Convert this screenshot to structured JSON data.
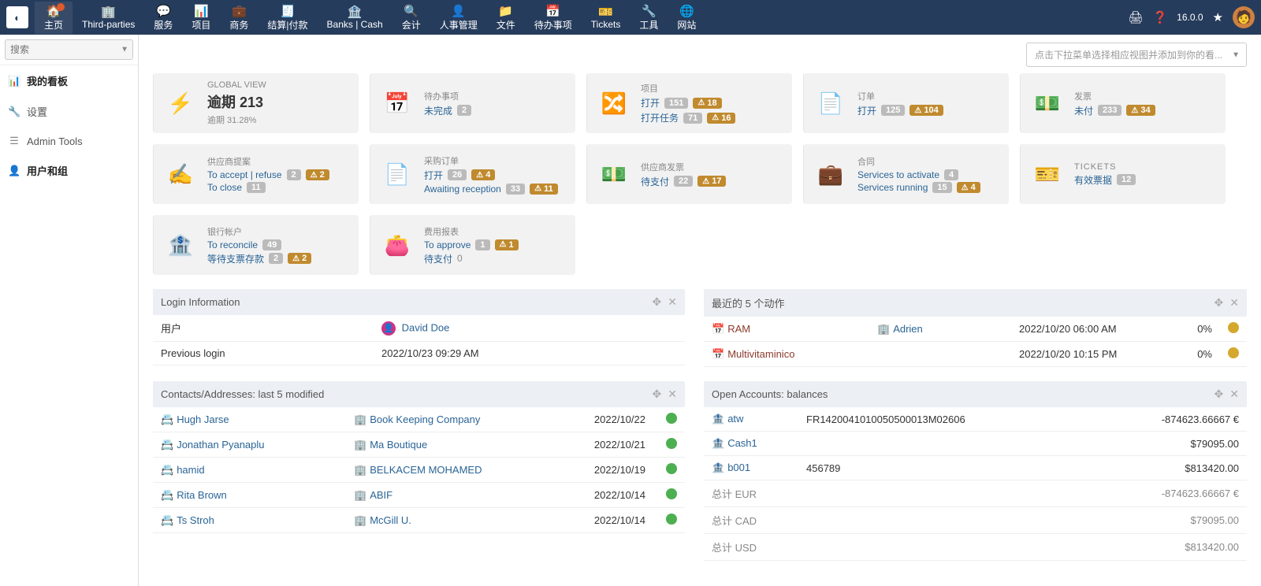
{
  "topnav": {
    "items": [
      {
        "label": "主页",
        "icon": "🏠",
        "active": true,
        "dot": true
      },
      {
        "label": "Third-parties",
        "icon": "🏢"
      },
      {
        "label": "服务",
        "icon": "💬"
      },
      {
        "label": "项目",
        "icon": "📊"
      },
      {
        "label": "商务",
        "icon": "💼"
      },
      {
        "label": "结算|付款",
        "icon": "🧾"
      },
      {
        "label": "Banks | Cash",
        "icon": "🏦"
      },
      {
        "label": "会计",
        "icon": "🔍"
      },
      {
        "label": "人事管理",
        "icon": "👤"
      },
      {
        "label": "文件",
        "icon": "📁"
      },
      {
        "label": "待办事项",
        "icon": "📅"
      },
      {
        "label": "Tickets",
        "icon": "🎫"
      },
      {
        "label": "工具",
        "icon": "🔧"
      },
      {
        "label": "网站",
        "icon": "🌐"
      }
    ],
    "version": "16.0.0"
  },
  "sidebar": {
    "search_placeholder": "搜索",
    "items": [
      {
        "label": "我的看板",
        "icon": "📊",
        "strong": true
      },
      {
        "label": "设置",
        "icon": "🔧"
      },
      {
        "label": "Admin Tools",
        "icon": "☰"
      },
      {
        "label": "用户和组",
        "icon": "👤",
        "strong": true
      }
    ]
  },
  "viewselect_placeholder": "点击下拉菜单选择相应视图并添加到你的看...",
  "cards": [
    {
      "title": "GLOBAL VIEW",
      "iconColor": "#b02418",
      "icon": "⚡",
      "rows": [
        {
          "bigLabel": "逾期",
          "bigVal": "213"
        },
        {
          "text": "逾期 31.28%",
          "muted": true
        }
      ]
    },
    {
      "title": "待办事项",
      "iconColor": "#6b7a99",
      "icon": "📅",
      "rows": [
        {
          "label": "未完成",
          "badge": "2"
        }
      ]
    },
    {
      "title": "项目",
      "iconColor": "#6b7a99",
      "icon": "🔀",
      "rows": [
        {
          "label": "打开",
          "badge": "151",
          "warn": "18"
        },
        {
          "label": "打开任务",
          "badge": "71",
          "warn": "16"
        }
      ]
    },
    {
      "title": "订单",
      "iconColor": "#6aa84f",
      "icon": "📄",
      "rows": [
        {
          "label": "打开",
          "badge": "125",
          "warn": "104"
        }
      ]
    },
    {
      "title": "发票",
      "iconColor": "#6aa84f",
      "icon": "💵",
      "rows": [
        {
          "label": "未付",
          "badge": "233",
          "warn": "34"
        }
      ]
    },
    {
      "title": "供应商提案",
      "iconColor": "#6b7a99",
      "icon": "✍",
      "rows": [
        {
          "label": "To accept | refuse",
          "badge": "2",
          "warn": "2"
        },
        {
          "label": "To close",
          "badge": "11"
        }
      ]
    },
    {
      "title": "采购订单",
      "iconColor": "#6b7a99",
      "icon": "📄",
      "rows": [
        {
          "label": "打开",
          "badge": "26",
          "warn": "4"
        },
        {
          "label": "Awaiting reception",
          "badge": "33",
          "warn": "11"
        }
      ]
    },
    {
      "title": "供应商发票",
      "iconColor": "#6b7a99",
      "icon": "💵",
      "rows": [
        {
          "label": "待支付",
          "badge": "22",
          "warn": "17"
        }
      ]
    },
    {
      "title": "合同",
      "iconColor": "#6b7a99",
      "icon": "💼",
      "rows": [
        {
          "label": "Services to activate",
          "badge": "4"
        },
        {
          "label": "Services running",
          "badge": "15",
          "warn": "4"
        }
      ]
    },
    {
      "title": "TICKETS",
      "isTicket": true,
      "iconColor": "#6b7a99",
      "icon": "🎫",
      "rows": [
        {
          "label": "有效票据",
          "badge": "12"
        }
      ]
    },
    {
      "title": "银行帐户",
      "iconColor": "#bfa24a",
      "icon": "🏦",
      "rows": [
        {
          "label": "To reconcile",
          "badge": "49"
        },
        {
          "label": "等待支票存款",
          "badge": "2",
          "warn": "2"
        }
      ]
    },
    {
      "title": "费用报表",
      "iconColor": "#6b5b3e",
      "icon": "👛",
      "rows": [
        {
          "label": "To approve",
          "badge": "1",
          "warn": "1"
        },
        {
          "label": "待支付",
          "gray": "0"
        }
      ]
    }
  ],
  "login": {
    "title": "Login Information",
    "rows": [
      {
        "k": "用户",
        "userName": "David Doe"
      },
      {
        "k": "Previous login",
        "v": "2022/10/23 09:29 AM"
      }
    ]
  },
  "actions": {
    "title": "最近的 5 个动作",
    "rows": [
      {
        "event": "RAM",
        "who": "Adrien",
        "when": "2022/10/20 06:00 AM",
        "pct": "0%"
      },
      {
        "event": "Multivitaminico",
        "who": "",
        "when": "2022/10/20 10:15 PM",
        "pct": "0%"
      }
    ]
  },
  "contacts": {
    "title": "Contacts/Addresses: last 5 modified",
    "rows": [
      {
        "name": "Hugh Jarse",
        "company": "Book Keeping Company",
        "date": "2022/10/22"
      },
      {
        "name": "Jonathan Pyanaplu",
        "company": "Ma Boutique",
        "date": "2022/10/21"
      },
      {
        "name": "hamid",
        "company": "BELKACEM MOHAMED",
        "date": "2022/10/19"
      },
      {
        "name": "Rita Brown",
        "company": "ABIF",
        "date": "2022/10/14"
      },
      {
        "name": "Ts Stroh",
        "company": "McGill U.",
        "date": "2022/10/14"
      }
    ]
  },
  "accounts": {
    "title": "Open Accounts: balances",
    "rows": [
      {
        "acc": "atw",
        "ref": "FR1420041010050500013M02606",
        "bal": "-874623.66667 €"
      },
      {
        "acc": "Cash1",
        "ref": "",
        "bal": "$79095.00"
      },
      {
        "acc": "b001",
        "ref": "456789",
        "bal": "$813420.00"
      }
    ],
    "totals": [
      {
        "label": "总计 EUR",
        "val": "-874623.66667 €"
      },
      {
        "label": "总计 CAD",
        "val": "$79095.00"
      },
      {
        "label": "总计 USD",
        "val": "$813420.00"
      }
    ]
  }
}
